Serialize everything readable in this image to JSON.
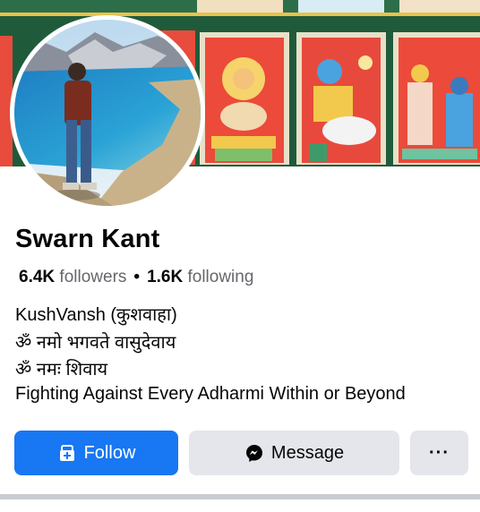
{
  "profile": {
    "name": "Swarn Kant",
    "followers_count": "6.4K",
    "followers_label": "followers",
    "separator": "•",
    "following_count": "1.6K",
    "following_label": "following",
    "bio": [
      "KushVansh (कुशवाहा)",
      "ॐ नमो भगवते वासुदेवाय",
      "ॐ नमः शिवाय",
      "Fighting Against Every Adharmi Within or Beyond"
    ]
  },
  "actions": {
    "follow_label": "Follow",
    "message_label": "Message",
    "more_label": "···"
  },
  "icons": {
    "follow": "follow-icon",
    "message": "messenger-icon"
  },
  "colors": {
    "accent": "#1877f2",
    "secondary_button": "#e4e6eb",
    "muted_text": "#65676b"
  }
}
